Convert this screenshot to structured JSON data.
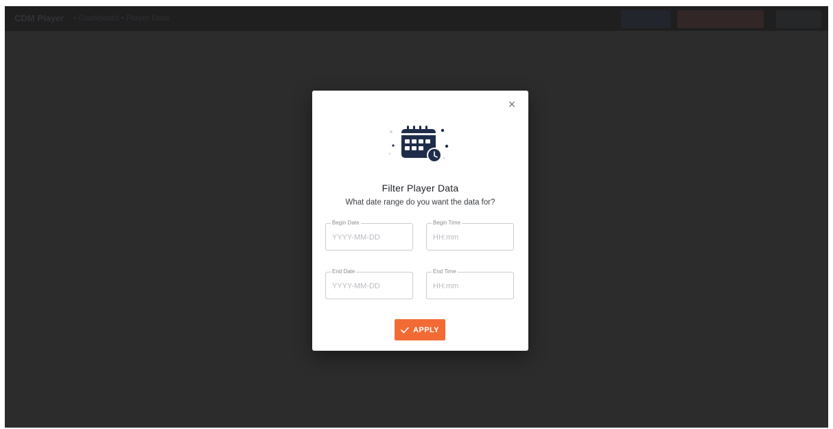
{
  "topbar": {
    "title": "CDM Player",
    "subtitle": "• Dashboard • Player Data"
  },
  "modal": {
    "close_icon": "×",
    "illustration": "calendar-clock-icon",
    "title": "Filter Player Data",
    "subtitle": "What date range do you want the data for?",
    "fields": {
      "begin_date": {
        "label": "Begin Date",
        "placeholder": "YYYY-MM-DD",
        "value": ""
      },
      "begin_time": {
        "label": "Begin Time",
        "placeholder": "HH:mm",
        "value": ""
      },
      "end_date": {
        "label": "End Date",
        "placeholder": "YYYY-MM-DD",
        "value": ""
      },
      "end_time": {
        "label": "End Time",
        "placeholder": "HH:mm",
        "value": ""
      }
    },
    "apply_label": "APPLY",
    "apply_icon": "check-icon"
  },
  "colors": {
    "backdrop": "#2c2c2d",
    "accent": "#f26b35",
    "icon_navy": "#1e2d4a"
  }
}
